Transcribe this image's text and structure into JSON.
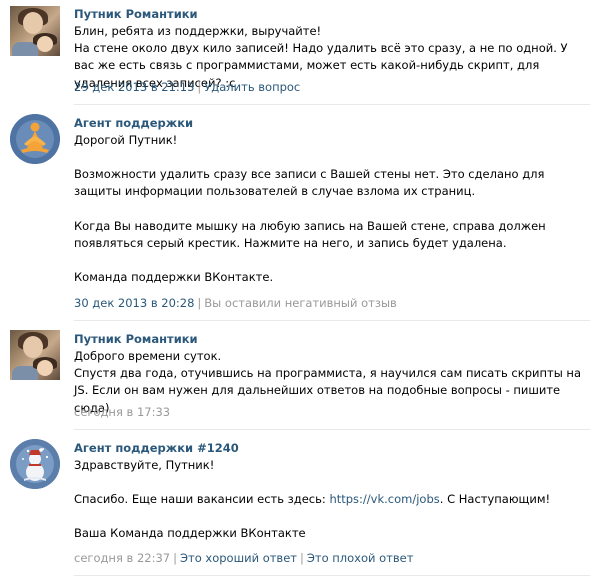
{
  "messages": [
    {
      "author": "Путник Романтики",
      "lines": [
        "Блин, ребята из поддержки, выручайте!",
        "На стене около двух кило записей! Надо удалить всё это сразу, а не по одной. У вас же есть связь с программистами, может есть какой-нибудь скрипт, для удаления всех записей? :с"
      ],
      "date": "29 дек 2013 в 21:13",
      "action": "Удалить вопрос"
    },
    {
      "author": "Агент поддержки",
      "lines": [
        "Дорогой Путник!",
        "Возможности удалить сразу все записи с Вашей стены нет. Это сделано для защиты информации пользователей в случае взлома их страниц.",
        "Когда Вы наводите мышку на любую запись на Вашей стене, справа должен появляться серый крестик. Нажмите на него, и запись будет удалена.",
        "Команда поддержки ВКонтакте."
      ],
      "date": "30 дек 2013 в 20:28",
      "status": "Вы оставили негативный отзыв"
    },
    {
      "author": "Путник Романтики",
      "lines": [
        "Доброго времени суток.",
        "Спустя два года, отучившись на программиста, я научился сам писать скрипты на JS. Если он вам нужен для дальнейших ответов на подобные вопросы - пишите сюда)"
      ],
      "date": "сегодня в 17:33"
    },
    {
      "author": "Агент поддержки #1240",
      "lines": [
        "Здравствуйте, Путник!",
        "Спасибо. Еще наши вакансии есть здесь:",
        "https://vk.com/jobs",
        ". С Наступающим!",
        "Ваша Команда поддержки ВКонтакте"
      ],
      "date": "сегодня в 22:37",
      "good_label": "Это хороший ответ",
      "bad_label": "Это плохой ответ"
    }
  ],
  "colors": {
    "link": "#2b587a",
    "meta": "#999999",
    "divider": "#e7e8ec",
    "agent_avatar": "#4f74a3"
  },
  "icons": {
    "agent_avatar_1": "meditating-figure-icon",
    "agent_avatar_2": "snowman-icon"
  }
}
